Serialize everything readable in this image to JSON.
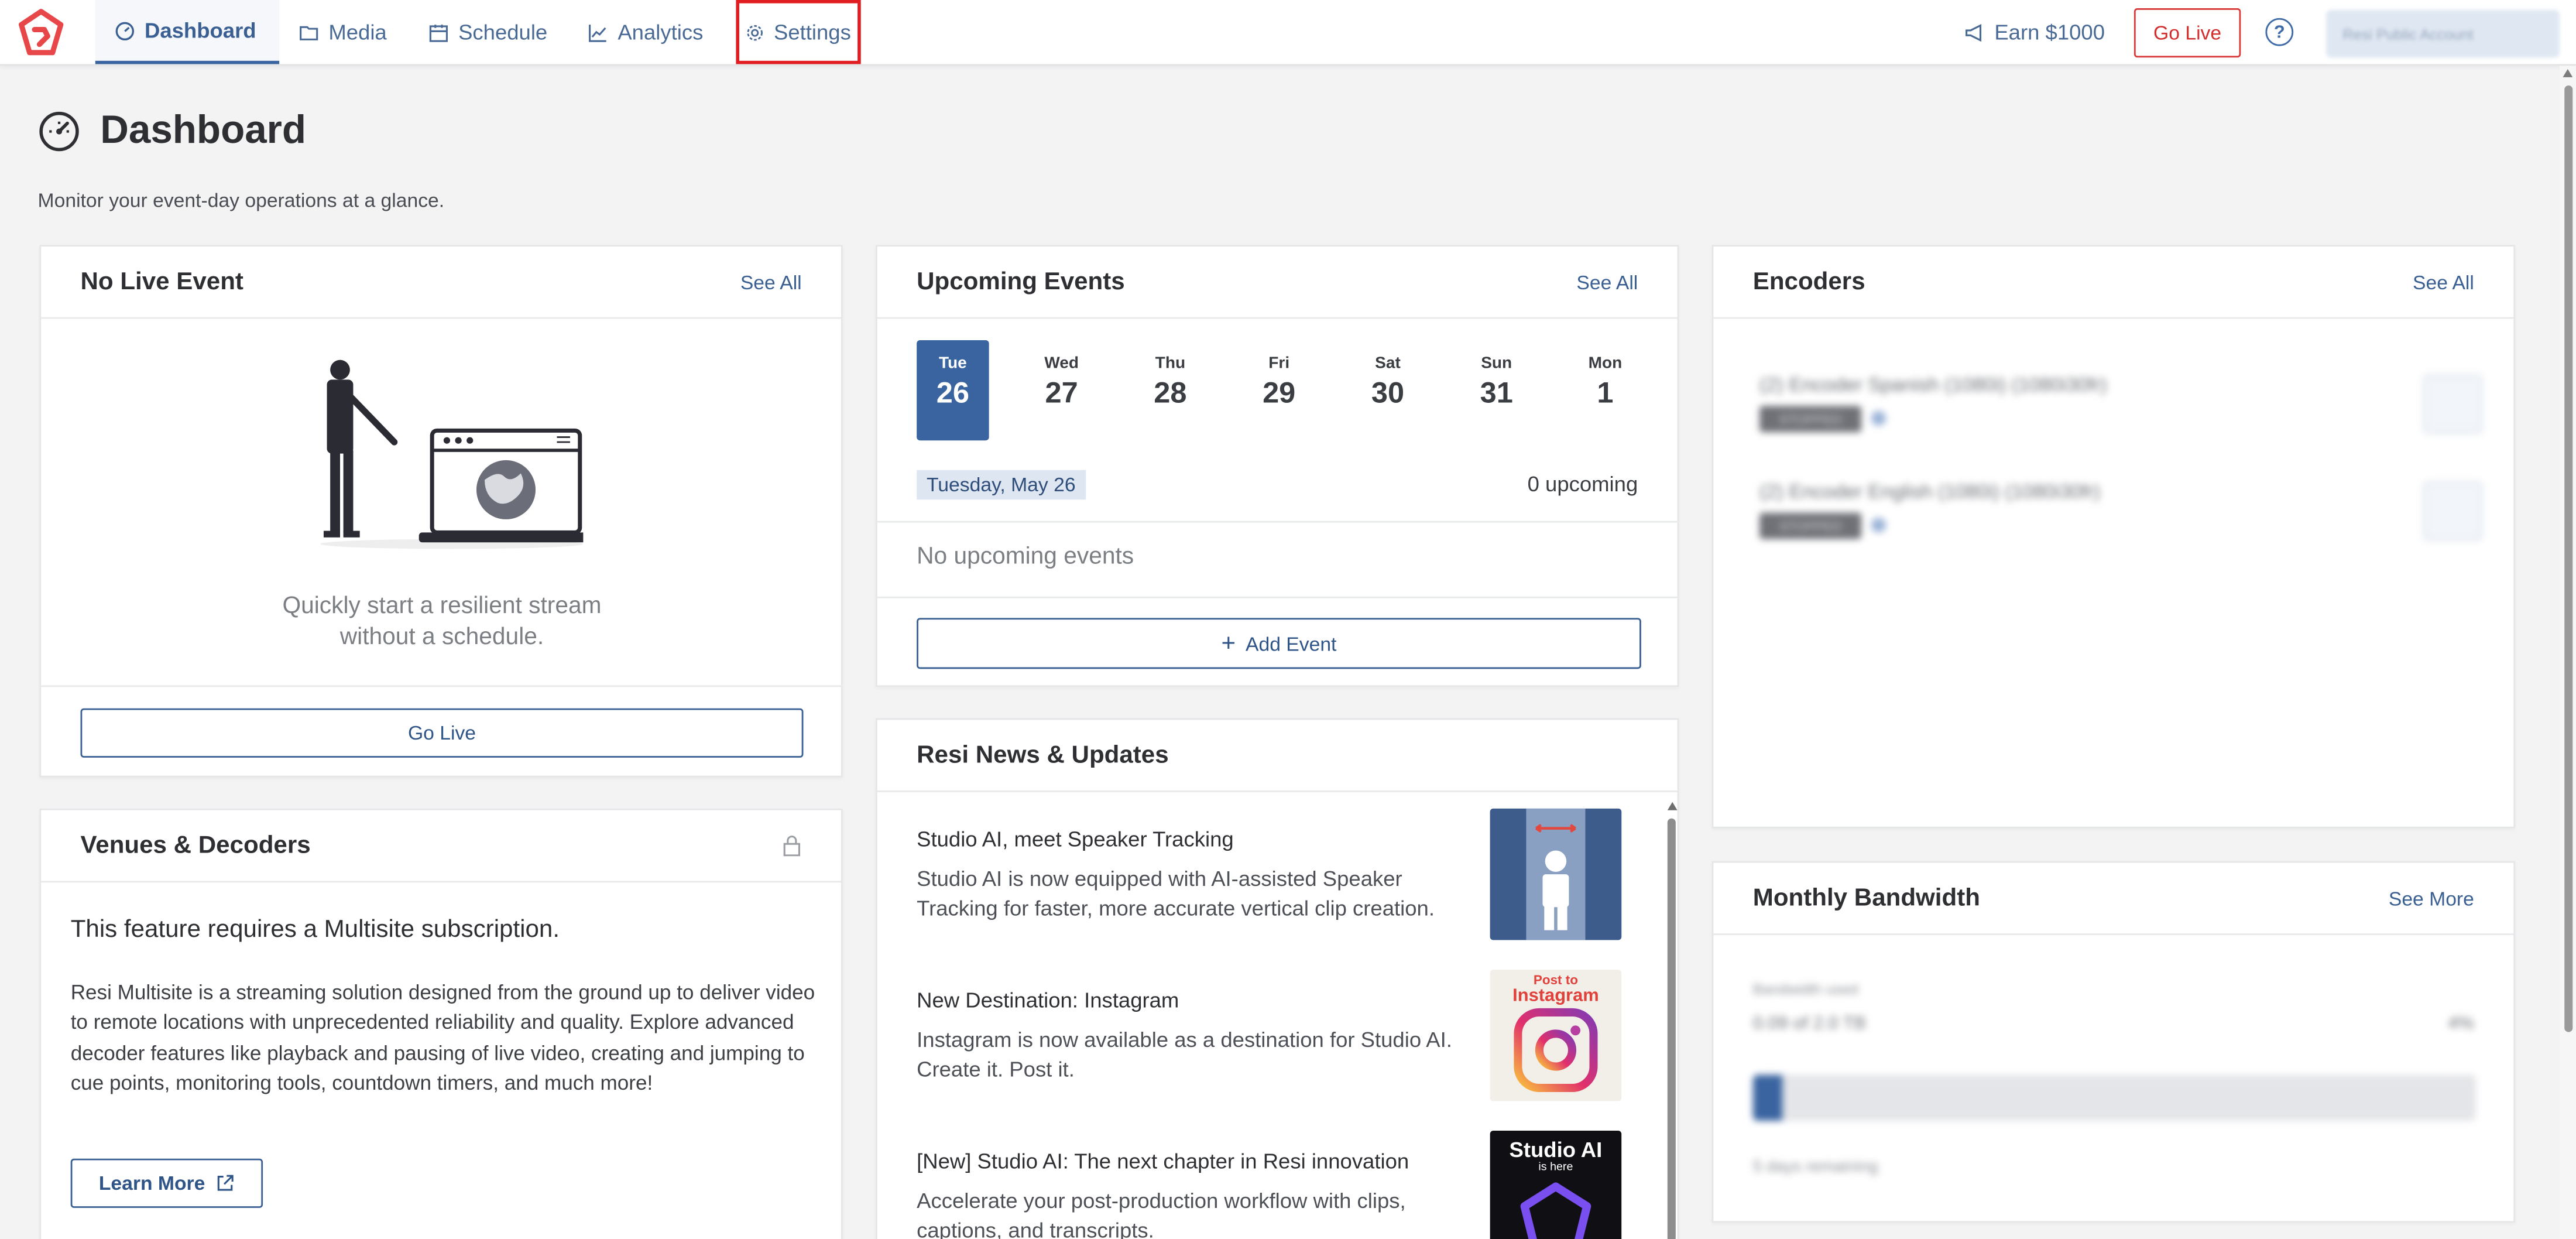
{
  "nav": {
    "tabs": [
      {
        "label": "Dashboard",
        "icon": "gauge-icon"
      },
      {
        "label": "Media",
        "icon": "folder-icon"
      },
      {
        "label": "Schedule",
        "icon": "calendar-icon"
      },
      {
        "label": "Analytics",
        "icon": "chart-icon"
      },
      {
        "label": "Settings",
        "icon": "gear-icon"
      }
    ],
    "earn_label": "Earn $1000",
    "go_live_label": "Go Live",
    "help_label": "?",
    "account_label": "Resi Public Account"
  },
  "page": {
    "title": "Dashboard",
    "subtitle": "Monitor your event-day operations at a glance."
  },
  "live": {
    "title": "No Live Event",
    "see_all": "See All",
    "empty_line1": "Quickly start a resilient stream",
    "empty_line2": "without a schedule.",
    "go_live_button": "Go Live"
  },
  "venues": {
    "title": "Venues & Decoders",
    "heading": "This feature requires a Multisite subscription.",
    "body": "Resi Multisite is a streaming solution designed from the ground up to deliver video to remote locations with unprecedented reliability and quality. Explore advanced decoder features like playback and pausing of live video, creating and jumping to cue points, monitoring tools, countdown timers, and much more!",
    "learn_more": "Learn More"
  },
  "upcoming": {
    "title": "Upcoming Events",
    "see_all": "See All",
    "days": [
      {
        "name": "Tue",
        "date": "26",
        "selected": true
      },
      {
        "name": "Wed",
        "date": "27"
      },
      {
        "name": "Thu",
        "date": "28"
      },
      {
        "name": "Fri",
        "date": "29"
      },
      {
        "name": "Sat",
        "date": "30"
      },
      {
        "name": "Sun",
        "date": "31"
      },
      {
        "name": "Mon",
        "date": "1"
      }
    ],
    "selected_date": "Tuesday, May 26",
    "count_label": "0 upcoming",
    "empty": "No upcoming events",
    "add_event": "Add Event"
  },
  "news": {
    "title": "Resi News & Updates",
    "items": [
      {
        "title": "Studio AI, meet Speaker Tracking",
        "body": "Studio AI is now equipped with AI-assisted Speaker Tracking for faster, more accurate vertical clip creation."
      },
      {
        "title": "New Destination: Instagram",
        "body": "Instagram is now available as a destination for Studio AI. Create it. Post it.",
        "thumb_text1": "Post to",
        "thumb_text2": "Instagram"
      },
      {
        "title": "[New] Studio AI: The next chapter in Resi innovation",
        "body": "Accelerate your post-production workflow with clips, captions, and transcripts.",
        "thumb_text1": "Studio AI",
        "thumb_text2": "is here"
      }
    ]
  },
  "encoders": {
    "title": "Encoders",
    "see_all": "See All",
    "items": [
      {
        "name": "(2) Encoder Spanish (1080i) (1080i30fr)",
        "status": "STOPPED"
      },
      {
        "name": "(2) Encoder English (1080i) (1080i30fr)",
        "status": "STOPPED"
      }
    ]
  },
  "bandwidth": {
    "title": "Monthly Bandwidth",
    "see_more": "See More",
    "label": "Bandwidth used",
    "value": "0.09 of 2.0 TB",
    "percent_text": "4%",
    "fill_fraction": 0.04,
    "remaining": "5 days remaining"
  },
  "colors": {
    "brand": "#e8474a",
    "accent": "#3a64a0",
    "go_live": "#d42d2d",
    "highlight": "#e11d22"
  }
}
